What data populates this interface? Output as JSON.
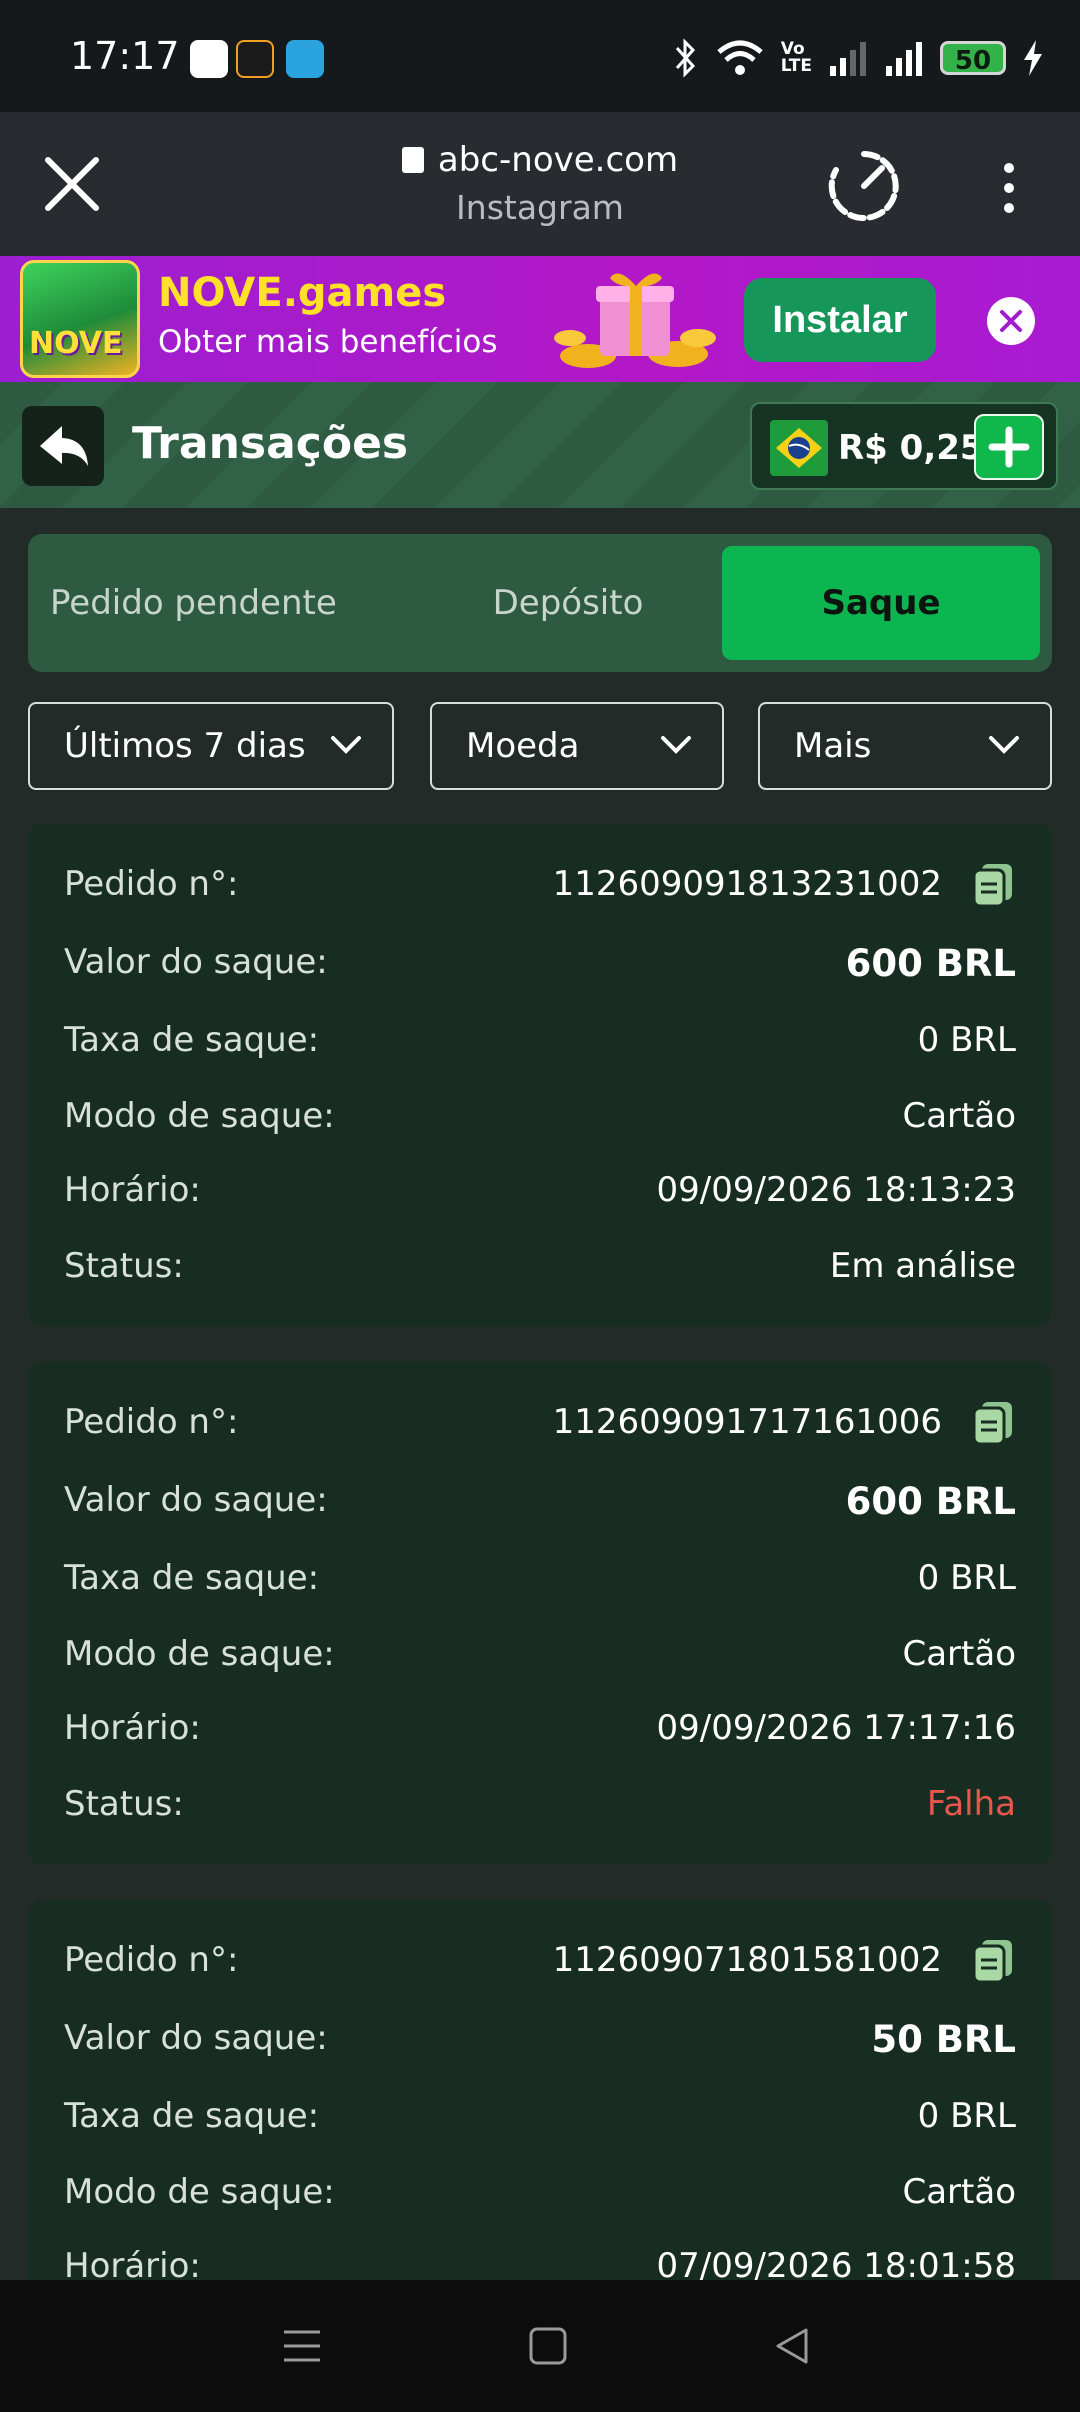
{
  "status_bar": {
    "time": "17:17",
    "battery": "50",
    "icons": [
      "mail-app-icon",
      "flame-app-icon",
      "telegram-icon",
      "bluetooth-icon",
      "wifi-icon",
      "volte-icon",
      "signal-icon",
      "signal-icon",
      "battery-icon",
      "charging-icon"
    ]
  },
  "browser": {
    "url": "abc-nove.com",
    "source": "Instagram"
  },
  "ad_banner": {
    "logo_text": "NOVE",
    "title": "NOVE.games",
    "subtitle": "Obter mais benefícios",
    "install_label": "Instalar"
  },
  "header": {
    "title": "Transações",
    "balance": "R$ 0,25"
  },
  "tabs": {
    "pending": "Pedido pendente",
    "deposit": "Depósito",
    "withdraw": "Saque"
  },
  "filters": {
    "period": "Últimos 7 dias",
    "currency": "Moeda",
    "more": "Mais"
  },
  "labels": {
    "order": "Pedido n°:",
    "amount": "Valor do saque:",
    "fee": "Taxa de saque:",
    "mode": "Modo de saque:",
    "time": "Horário:",
    "status": "Status:"
  },
  "transactions": [
    {
      "order_id": "112609091813231002",
      "amount": "600 BRL",
      "fee": "0 BRL",
      "mode": "Cartão",
      "time": "09/09/2026 18:13:23",
      "status": "Em análise"
    },
    {
      "order_id": "112609091717161006",
      "amount": "600 BRL",
      "fee": "0 BRL",
      "mode": "Cartão",
      "time": "09/09/2026 17:17:16",
      "status": "Falha"
    },
    {
      "order_id": "112609071801581002",
      "amount": "50 BRL",
      "fee": "0 BRL",
      "mode": "Cartão",
      "time": "07/09/2026 18:01:58",
      "status": ""
    }
  ],
  "colors": {
    "accent_green": "#0db551",
    "card_bg": "#172d22",
    "failure_red": "#e8574c",
    "ad_purple": "#b318c7"
  }
}
